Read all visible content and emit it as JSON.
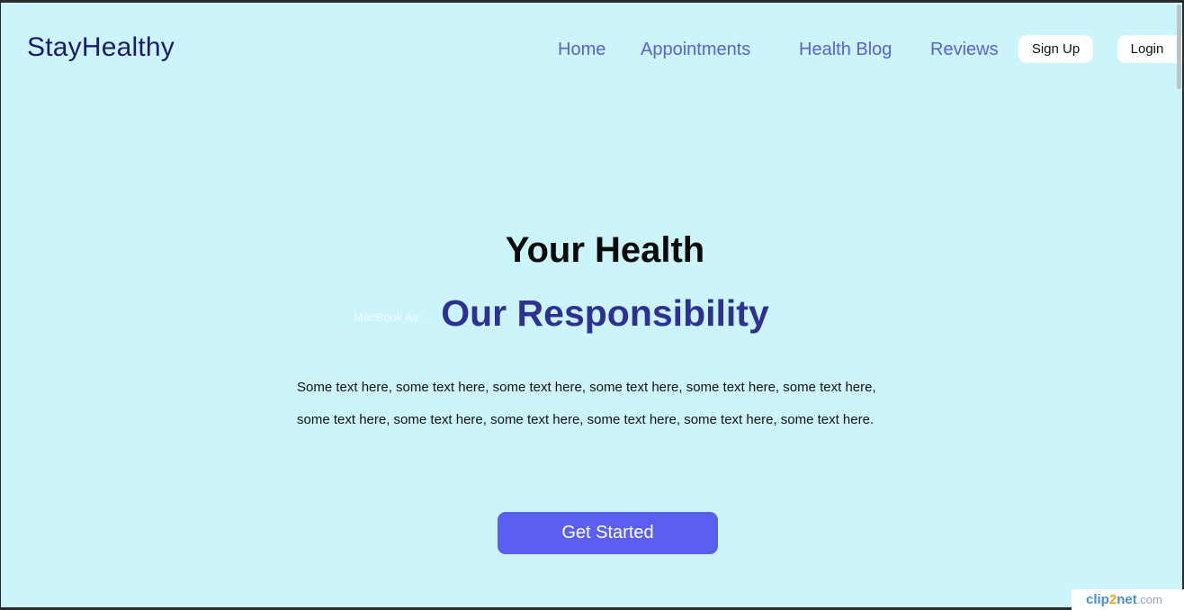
{
  "header": {
    "logo": "StayHealthy",
    "nav": [
      "Home",
      "Appointments",
      "Health Blog",
      "Reviews"
    ],
    "signup_label": "Sign Up",
    "login_label": "Login"
  },
  "hero": {
    "title": "Your Health",
    "subtitle": "Our Responsibility",
    "ghost_label": "MacBook Air - ",
    "body_line_1": "Some text here, some text here, some text here, some text here, some text here, some text here,",
    "body_line_2": "some text here, some text here, some text here, some text here, some text here, some text here.",
    "cta_label": "Get Started"
  },
  "watermark": {
    "part_a": "clip",
    "part_b": "2",
    "part_c": "net",
    "part_d": ".com"
  },
  "colors": {
    "background": "#cbf5fb",
    "logo": "#1b1b6b",
    "nav": "#5a60d6",
    "subtitle": "#2e3192",
    "cta": "#5b5ff0"
  }
}
